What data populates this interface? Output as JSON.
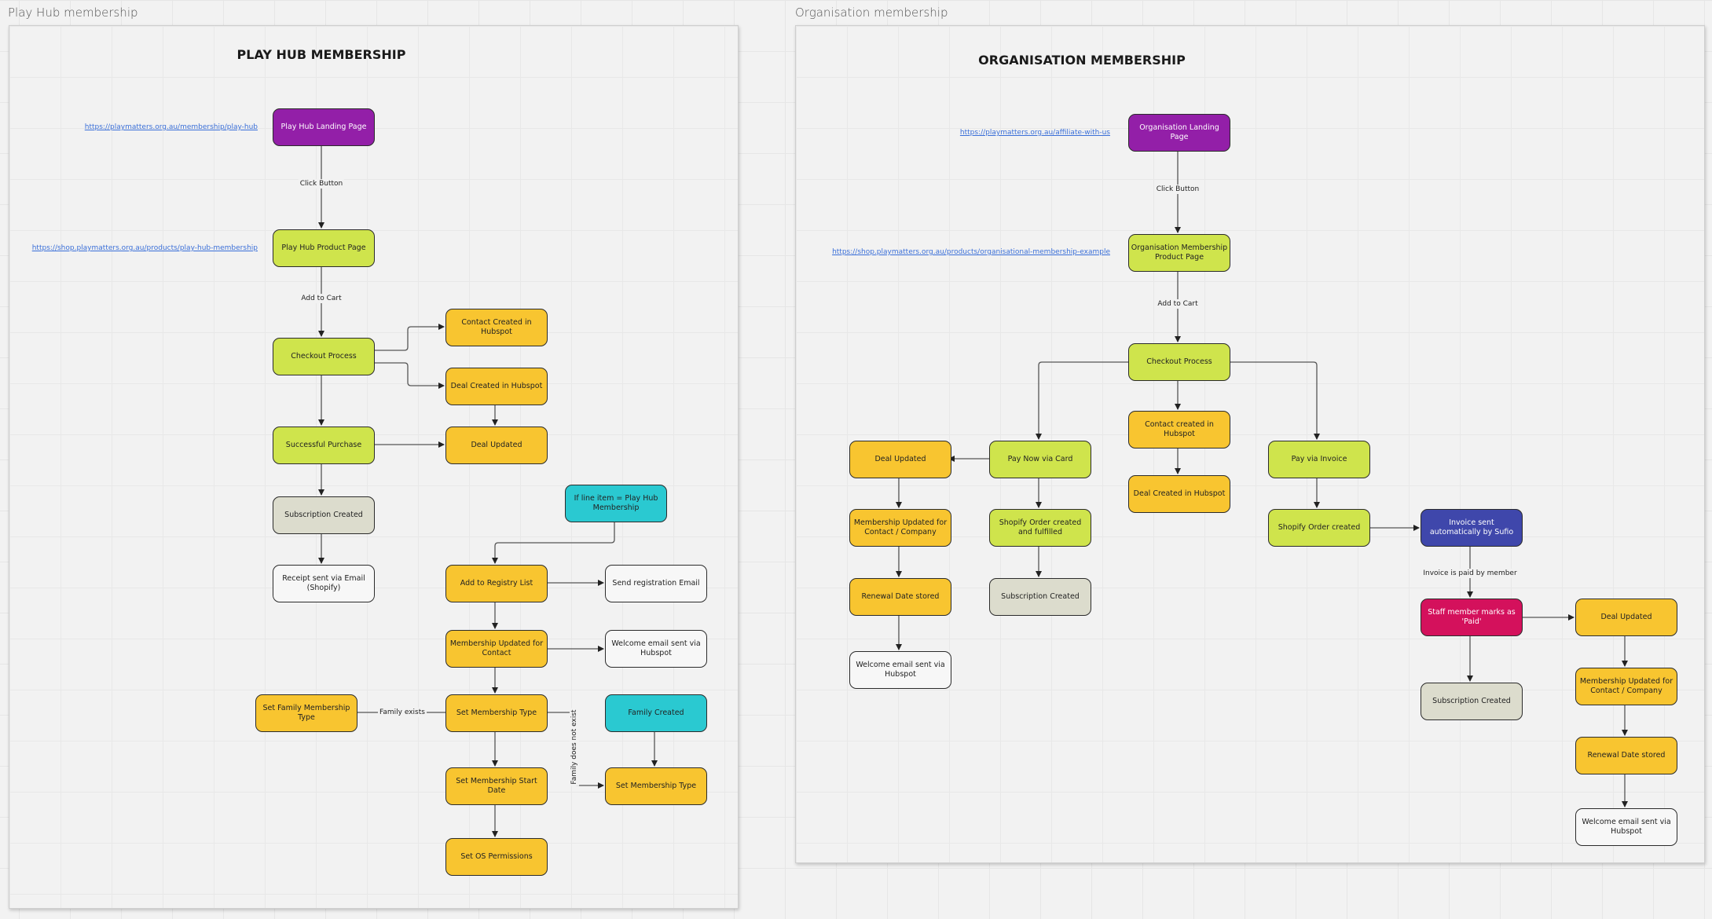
{
  "frames": {
    "play_hub": {
      "label": "Play Hub membership",
      "title": "PLAY HUB MEMBERSHIP",
      "links": {
        "landing_url": "https://playmatters.org.au/membership/play-hub",
        "product_url": "https://shop.playmatters.org.au/products/play-hub-membership"
      },
      "nodes": {
        "landing": "Play Hub Landing Page",
        "product": "Play Hub Product Page",
        "checkout": "Checkout Process",
        "purchase": "Successful Purchase",
        "subscription": "Subscription Created",
        "receipt": "Receipt sent via Email (Shopify)",
        "contact_created": "Contact Created in Hubspot",
        "deal_created": "Deal Created in Hubspot",
        "deal_updated": "Deal Updated",
        "if_line_item": "If line item = Play Hub Membership",
        "add_registry": "Add to Registry List",
        "send_registration": "Send registration Email",
        "membership_updated": "Membership Updated for Contact",
        "welcome_email": "Welcome email sent via Hubspot",
        "set_family_type": "Set Family Membership Type",
        "set_type": "Set Membership Type",
        "family_created": "Family Created",
        "set_start_date": "Set Membership Start Date",
        "set_type_2": "Set Membership Type",
        "set_os_permissions": "Set OS Permissions"
      },
      "edge_labels": {
        "click_button": "Click Button",
        "add_to_cart": "Add to Cart",
        "family_exists": "Family exists",
        "family_not_exist": "Family does not exist"
      }
    },
    "organisation": {
      "label": "Organisation membership",
      "title": "ORGANISATION MEMBERSHIP",
      "links": {
        "landing_url": "https://playmatters.org.au/affiliate-with-us",
        "product_url": "https://shop.playmatters.org.au/products/organisational-membership-example"
      },
      "nodes": {
        "landing": "Organisation Landing Page",
        "product": "Organisation Membership Product Page",
        "checkout": "Checkout Process",
        "contact_created": "Contact created in Hubspot",
        "deal_created": "Deal Created in Hubspot",
        "deal_updated": "Deal Updated",
        "pay_card": "Pay Now via Card",
        "pay_invoice": "Pay via Invoice",
        "membership_updated": "Membership Updated for Contact / Company",
        "shopify_fulfilled": "Shopify Order created and fulfilled",
        "shopify_created": "Shopify Order created",
        "invoice_sent": "Invoice sent automatically by Sufio",
        "renewal": "Renewal Date stored",
        "subscription": "Subscription Created",
        "staff_paid": "Staff member marks as 'Paid'",
        "deal_updated_2": "Deal Updated",
        "welcome_email": "Welcome email sent via Hubspot",
        "subscription_2": "Subscription Created",
        "membership_updated_2": "Membership Updated for Contact / Company",
        "renewal_2": "Renewal Date stored",
        "welcome_email_2": "Welcome email sent via Hubspot"
      },
      "edge_labels": {
        "click_button": "Click Button",
        "add_to_cart": "Add to Cart",
        "invoice_paid": "Invoice is paid by member"
      }
    }
  },
  "colors": {
    "purple": "#931fa8",
    "lime": "#cfe44c",
    "orange": "#f8c530",
    "grey": "#dcdccd",
    "white": "#f7f7f7",
    "cyan": "#2ac9d1",
    "blue": "#3f47ab",
    "pink": "#d4115c",
    "link": "#3a6fd8"
  }
}
